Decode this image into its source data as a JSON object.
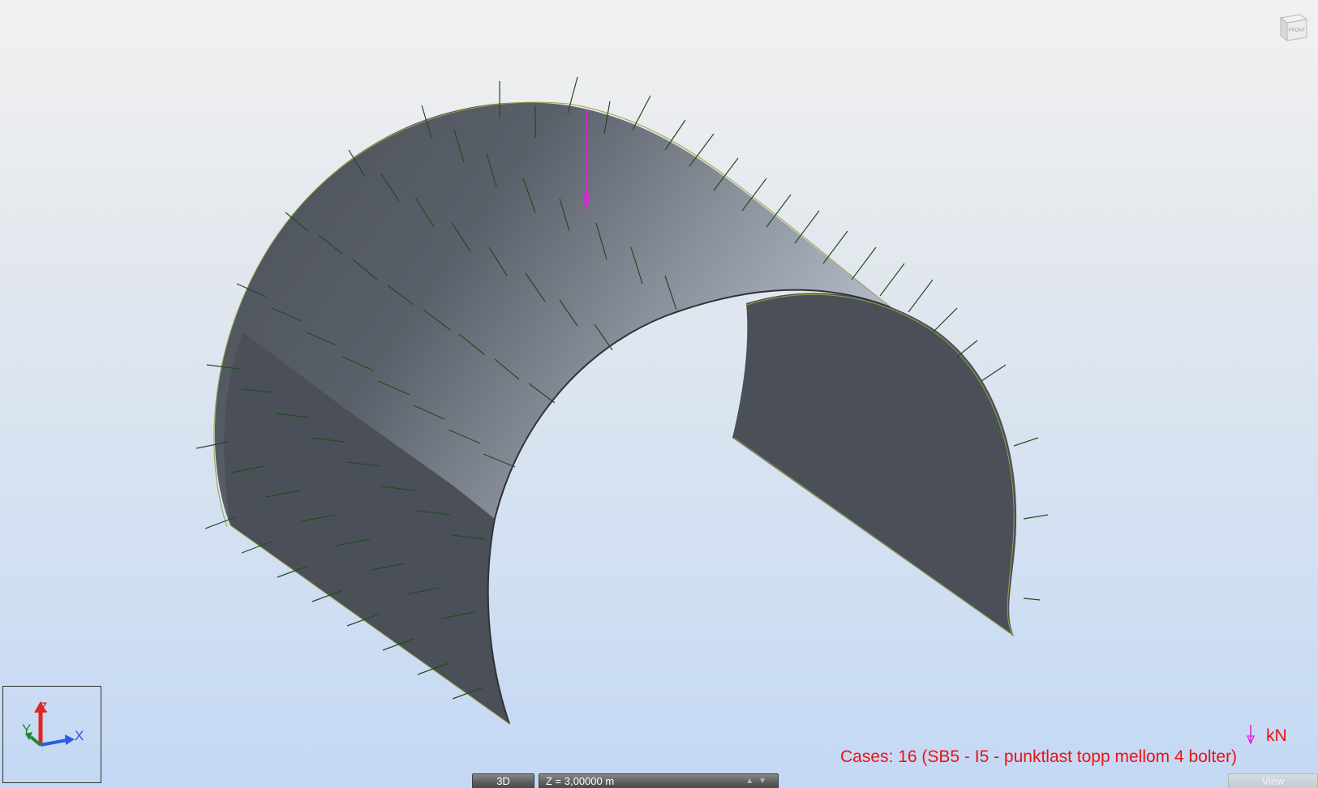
{
  "viewport": {
    "view_cube_face": "FRONT",
    "axes": {
      "z": "Z",
      "y": "Y",
      "x": "X"
    },
    "load_unit": "kN",
    "cases_label": "Cases: 16 (SB5 - I5 - punktlast topp mellom 4 bolter)"
  },
  "bottom_bar": {
    "view_3d_tab": "3D",
    "z_level": "Z = 3,00000 m",
    "view_tab": "View"
  },
  "icons": {
    "view_cube": "view-cube-icon",
    "axis_triad": "axis-triad-icon",
    "point_load": "point-load-arrow-icon",
    "level_up": "up-arrow-icon",
    "level_down": "down-arrow-icon"
  },
  "colors": {
    "label_red": "#ee1111",
    "point_load": "#e020e0",
    "surface_load_symbol": "#1f4d1f",
    "shell_edge": "#9aa040",
    "axis_x": "#2a5be0",
    "axis_y": "#1d8a2a",
    "axis_z": "#e02525"
  }
}
